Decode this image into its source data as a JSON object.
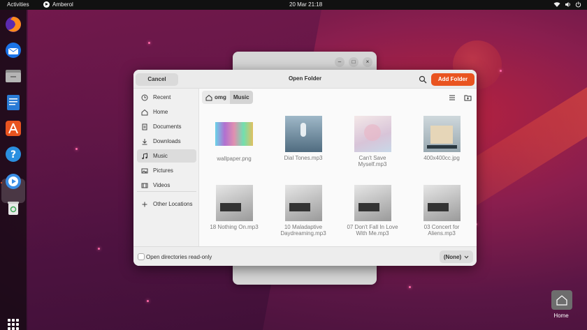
{
  "topbar": {
    "activities": "Activities",
    "app_name": "Amberol",
    "clock": "20 Mar  21:18"
  },
  "dock": {
    "apps": [
      "firefox-icon",
      "thunderbird-icon",
      "files-icon",
      "writer-icon",
      "app-center-icon",
      "help-icon",
      "amberol-icon",
      "trash-icon"
    ],
    "active": "amberol-icon"
  },
  "dialog": {
    "title": "Open Folder",
    "cancel_label": "Cancel",
    "add_label": "Add Folder",
    "sidebar": [
      {
        "label": "Recent",
        "icon": "clock-icon"
      },
      {
        "label": "Home",
        "icon": "home-icon"
      },
      {
        "label": "Documents",
        "icon": "document-icon"
      },
      {
        "label": "Downloads",
        "icon": "download-icon"
      },
      {
        "label": "Music",
        "icon": "music-icon",
        "selected": true
      },
      {
        "label": "Pictures",
        "icon": "picture-icon"
      },
      {
        "label": "Videos",
        "icon": "video-icon"
      },
      {
        "label": "Other Locations",
        "icon": "plus-icon"
      }
    ],
    "path": [
      "omg",
      "Music"
    ],
    "files": [
      {
        "name": "wallpaper.png"
      },
      {
        "name": "Dial Tones.mp3"
      },
      {
        "name": "Can't Save\nMyself.mp3"
      },
      {
        "name": "400x400cc.jpg"
      },
      {
        "name": "18 Nothing On.mp3"
      },
      {
        "name": "10 Maladaptive\nDaydreaming.mp3"
      },
      {
        "name": "07 Don't Fall In Love\nWith Me.mp3"
      },
      {
        "name": "03 Concert for\nAliens.mp3"
      }
    ],
    "footer": {
      "readonly_label": "Open directories read-only",
      "filter_label": "(None)"
    }
  },
  "desktop": {
    "home_label": "Home"
  },
  "colors": {
    "accent": "#e95420",
    "topbar": "#111111"
  }
}
